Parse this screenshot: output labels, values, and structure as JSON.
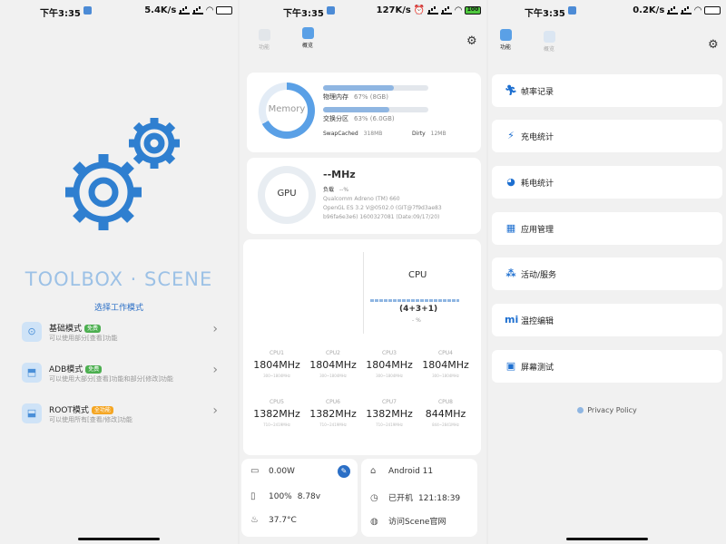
{
  "screen1": {
    "status": {
      "time": "下午3:35",
      "speed": "5.4K/s"
    },
    "brand": "TOOLBOX · SCENE",
    "choose_label": "选择工作模式",
    "modes": [
      {
        "icon": "basic-mode-icon",
        "title": "基础模式",
        "badge": "免费",
        "desc": "可以使用部分[查看]功能"
      },
      {
        "icon": "adb-mode-icon",
        "title": "ADB模式",
        "badge": "免费",
        "desc": "可以使用大部分[查看]功能和部分[修改]功能"
      },
      {
        "icon": "root-mode-icon",
        "title": "ROOT模式",
        "badge": "全功能",
        "desc": "可以使用所有[查看/修改]功能"
      }
    ]
  },
  "screen2": {
    "status": {
      "time": "下午3:35",
      "speed": "127K/s",
      "battery": "100"
    },
    "nav": {
      "functions": "功能",
      "overview": "概览"
    },
    "memory": {
      "ring_label": "Memory",
      "physical_label": "物理内存",
      "physical_value": "67% (8GB)",
      "physical_pct": 67,
      "swap_label": "交换分区",
      "swap_value": "63% (6.0GB)",
      "swap_pct": 63,
      "swapcached_label": "SwapCached",
      "swapcached_value": "318MB",
      "dirty_label": "Dirty",
      "dirty_value": "12MB"
    },
    "gpu": {
      "ring_label": "GPU",
      "freq": "--MHz",
      "load_label": "负载",
      "load_value": "--%",
      "renderer": "Qualcomm Adreno (TM) 660",
      "gl_version": "OpenGL ES 3.2 V@0502.0 (GIT@7f9d3ae83",
      "gl_build": "b96fa6e3e6) 1600327081 (Date:09/17/20)"
    },
    "cpu": {
      "title": "CPU",
      "cluster": "(4+3+1)",
      "load": "- %",
      "cores": [
        {
          "name": "CPU1",
          "freq": "1804MHz",
          "range": "300~1804MHz"
        },
        {
          "name": "CPU2",
          "freq": "1804MHz",
          "range": "300~1804MHz"
        },
        {
          "name": "CPU3",
          "freq": "1804MHz",
          "range": "300~1804MHz"
        },
        {
          "name": "CPU4",
          "freq": "1804MHz",
          "range": "300~1804MHz"
        },
        {
          "name": "CPU5",
          "freq": "1382MHz",
          "range": "710~2419MHz"
        },
        {
          "name": "CPU6",
          "freq": "1382MHz",
          "range": "710~2419MHz"
        },
        {
          "name": "CPU7",
          "freq": "1382MHz",
          "range": "710~2419MHz"
        },
        {
          "name": "CPU8",
          "freq": "844MHz",
          "range": "844~2841MHz"
        }
      ]
    },
    "battery_info": {
      "power": "0.00W",
      "level": "100%",
      "voltage": "8.78v",
      "temp": "37.7°C"
    },
    "system_info": {
      "android": "Android 11",
      "uptime_label": "已开机",
      "uptime": "121:18:39",
      "website": "访问Scene官网"
    }
  },
  "screen3": {
    "status": {
      "time": "下午3:35",
      "speed": "0.2K/s"
    },
    "nav": {
      "functions": "功能",
      "overview": "概览"
    },
    "menu": [
      {
        "icon": "run-icon",
        "label": "帧率记录"
      },
      {
        "icon": "charge-icon",
        "label": "充电统计"
      },
      {
        "icon": "pie-icon",
        "label": "耗电统计"
      },
      {
        "icon": "apps-icon",
        "label": "应用管理"
      },
      {
        "icon": "activity-icon",
        "label": "活动/服务"
      },
      {
        "icon": "mi-icon",
        "label": "温控编辑"
      },
      {
        "icon": "screen-icon",
        "label": "屏幕测试"
      }
    ],
    "privacy": "Privacy Policy"
  },
  "colors": {
    "accent": "#2b6fc6",
    "ring": "#5aa0e6",
    "brand": "#9cc1e6",
    "gear": "#2f7fd0"
  }
}
